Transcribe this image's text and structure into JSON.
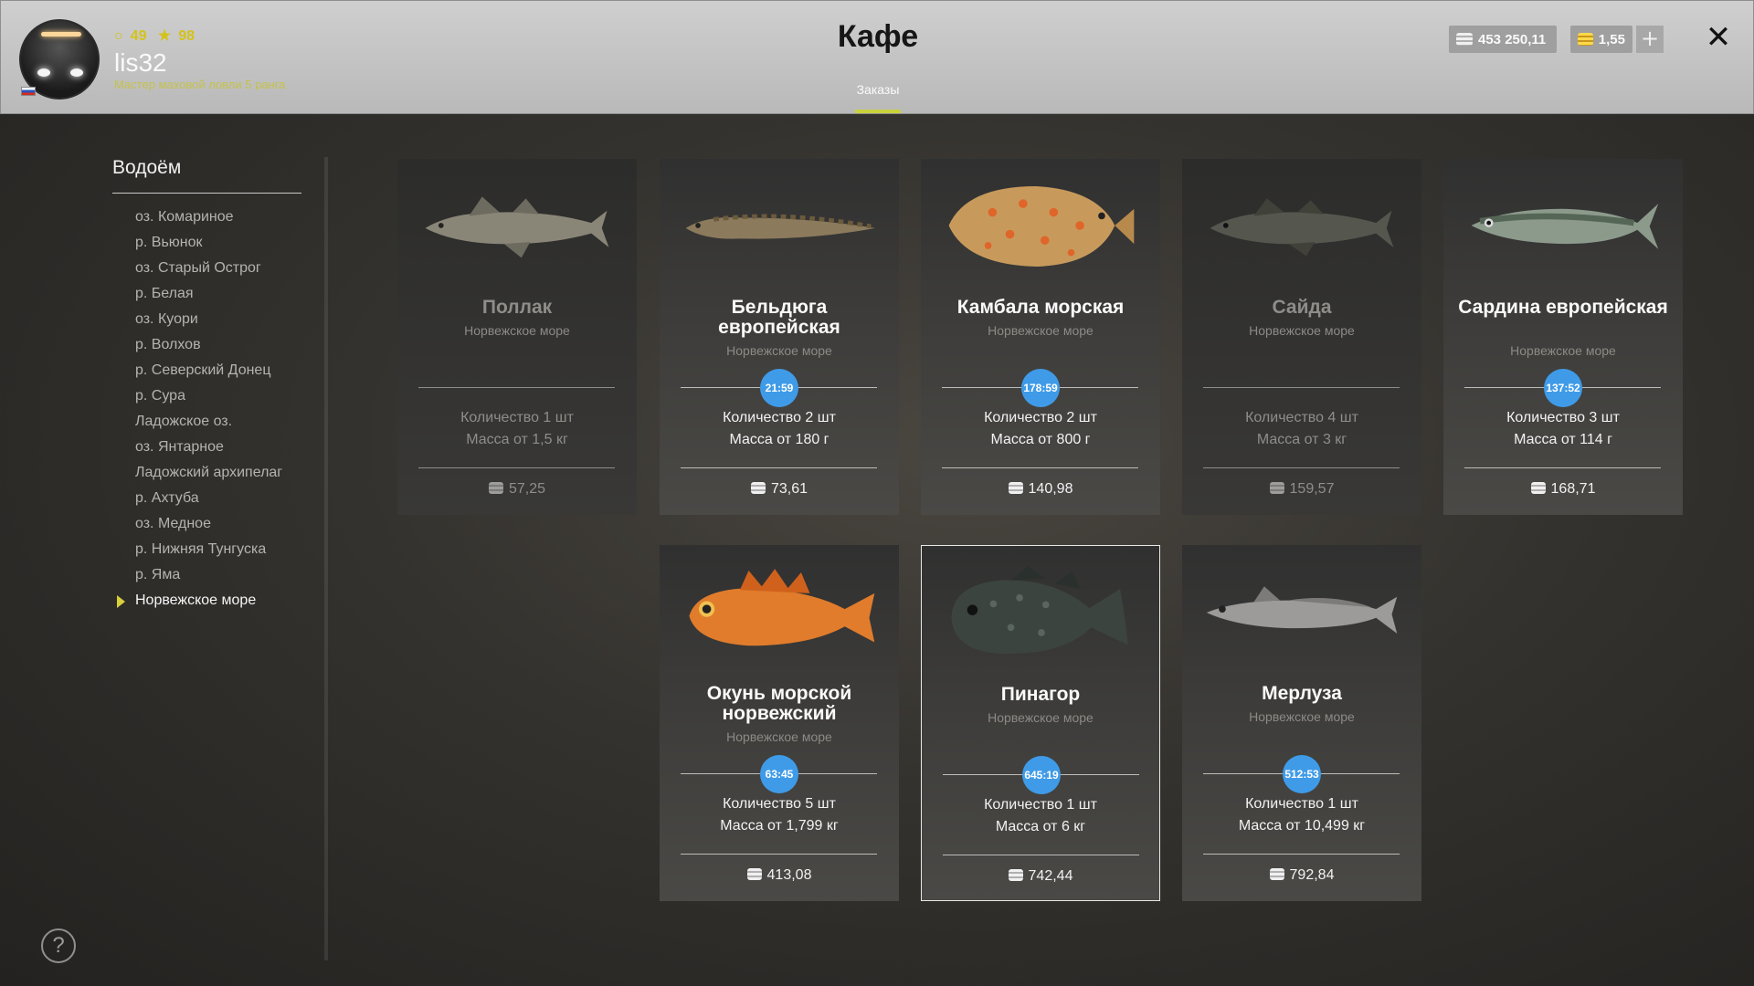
{
  "player": {
    "level": "49",
    "stars": "98",
    "name": "lis32",
    "rank": "Мастер маховой ловли 5 ранга"
  },
  "header": {
    "title": "Кафе",
    "tab": "Заказы",
    "silver": "453 250,11",
    "gold": "1,55"
  },
  "sidebar": {
    "title": "Водоём",
    "items": [
      "оз. Комариное",
      "р. Вьюнок",
      "оз. Старый Острог",
      "р. Белая",
      "оз. Куори",
      "р. Волхов",
      "р. Северский Донец",
      "р. Сура",
      "Ладожское оз.",
      "оз. Янтарное",
      "Ладожский архипелаг",
      "р. Ахтуба",
      "оз. Медное",
      "р. Нижняя Тунгуска",
      "р. Яма",
      "Норвежское море"
    ],
    "active_index": 15
  },
  "orders": [
    {
      "name": "Поллак",
      "location": "Норвежское море",
      "qty": "Количество 1 шт",
      "mass": "Масса от 1,5 кг",
      "price": "57,25",
      "timer": "",
      "active": false,
      "fish": "pollack-fish"
    },
    {
      "name": "Бельдюга европейская",
      "location": "Норвежское море",
      "qty": "Количество 2 шт",
      "mass": "Масса от 180 г",
      "price": "73,61",
      "timer": "21:59",
      "active": true,
      "fish": "eelpout-fish"
    },
    {
      "name": "Камбала морская",
      "location": "Норвежское море",
      "qty": "Количество 2 шт",
      "mass": "Масса от 800 г",
      "price": "140,98",
      "timer": "178:59",
      "active": true,
      "fish": "plaice-fish"
    },
    {
      "name": "Сайда",
      "location": "Норвежское море",
      "qty": "Количество 4 шт",
      "mass": "Масса от 3 кг",
      "price": "159,57",
      "timer": "",
      "active": false,
      "fish": "saithe-fish"
    },
    {
      "name": "Сардина европейская",
      "location": "Норвежское море",
      "qty": "Количество 3 шт",
      "mass": "Масса от 114 г",
      "price": "168,71",
      "timer": "137:52",
      "active": true,
      "fish": "sardine-fish"
    },
    {
      "name": "Окунь морской норвежский",
      "location": "Норвежское море",
      "qty": "Количество 5 шт",
      "mass": "Масса от 1,799 кг",
      "price": "413,08",
      "timer": "63:45",
      "active": true,
      "fish": "redfish-fish"
    },
    {
      "name": "Пинагор",
      "location": "Норвежское море",
      "qty": "Количество 1 шт",
      "mass": "Масса от 6 кг",
      "price": "742,44",
      "timer": "645:19",
      "active": true,
      "fish": "lumpfish-fish"
    },
    {
      "name": "Мерлуза",
      "location": "Норвежское море",
      "qty": "Количество 1 шт",
      "mass": "Масса от 10,499 кг",
      "price": "792,84",
      "timer": "512:53",
      "active": true,
      "fish": "hake-fish"
    }
  ],
  "colors": {
    "accent_yellow": "#c8d23c",
    "timer_blue": "#3f9be8"
  },
  "icons": {
    "help": "?",
    "close": "✕",
    "plus": "+"
  }
}
